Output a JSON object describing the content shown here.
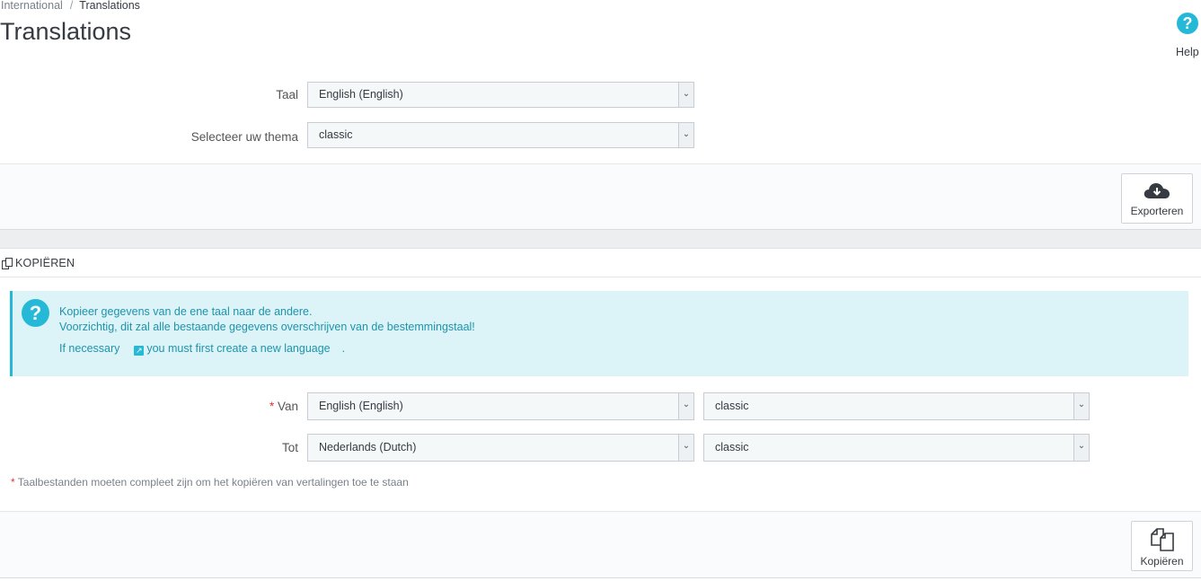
{
  "breadcrumb": {
    "parent": "International",
    "separator": "/",
    "current": "Translations"
  },
  "page": {
    "title": "Translations",
    "help_label": "Help",
    "help_icon": "?"
  },
  "export_panel": {
    "language_label": "Taal",
    "language_value": "English (English)",
    "theme_label": "Selecteer uw thema",
    "theme_value": "classic",
    "export_button": "Exporteren"
  },
  "copy_panel": {
    "heading": "KOPIËREN",
    "alert": {
      "icon": "?",
      "line1": "Kopieer gegevens van de ene taal naar de andere.",
      "line2": "Voorzichtig, dit zal alle bestaande gegevens overschrijven van de bestemmingstaal!",
      "line3_prefix": "If necessary",
      "line3_link": "you must first create a new language",
      "line3_suffix": "."
    },
    "from_label": "Van",
    "from_language": "English (English)",
    "from_theme": "classic",
    "to_label": "Tot",
    "to_language": "Nederlands (Dutch)",
    "to_theme": "classic",
    "required_marker": "*",
    "note": "Taalbestanden moeten compleet zijn om het kopiëren van vertalingen toe te staan",
    "copy_button": "Kopiëren"
  },
  "colors": {
    "accent": "#25b9d7",
    "alert_bg": "#dcf3f8",
    "required": "#e3342f"
  }
}
